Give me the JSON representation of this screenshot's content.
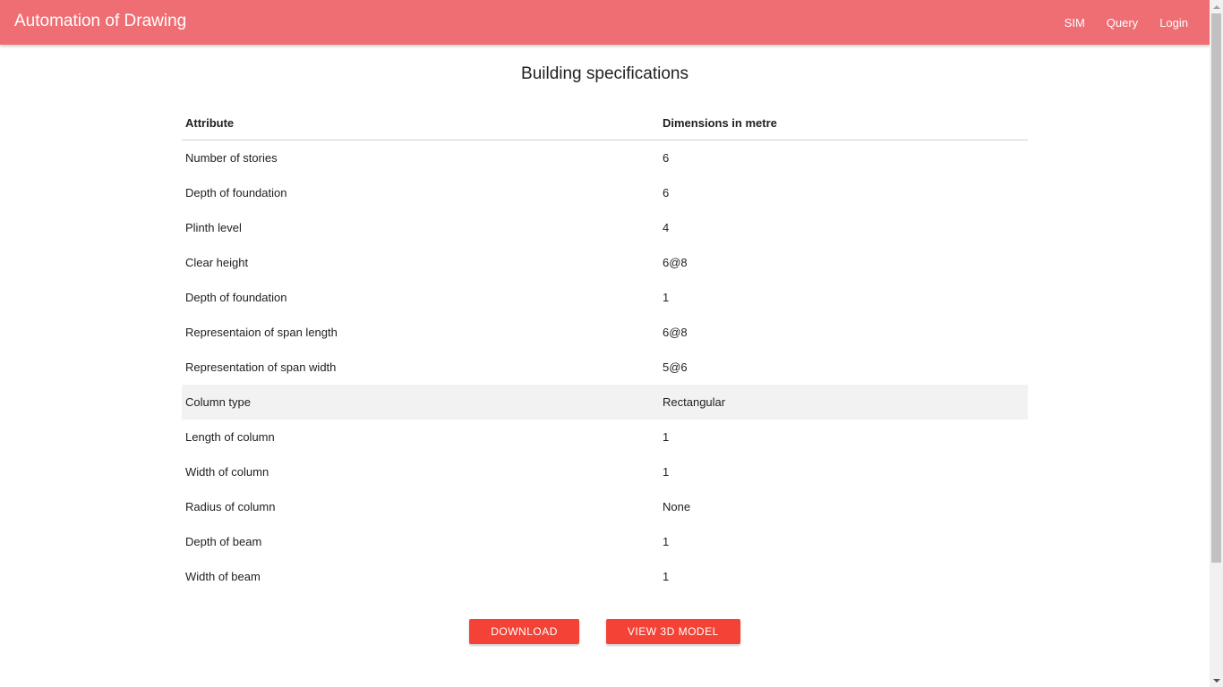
{
  "navbar": {
    "brand": "Automation of Drawing",
    "links": [
      "SIM",
      "Query",
      "Login"
    ]
  },
  "page": {
    "title": "Building specifications"
  },
  "table": {
    "headers": [
      "Attribute",
      "Dimensions in metre"
    ],
    "rows": [
      [
        "Number of stories",
        "6"
      ],
      [
        "Depth of foundation",
        "6"
      ],
      [
        "Plinth level",
        "4"
      ],
      [
        "Clear height",
        "6@8"
      ],
      [
        "Depth of foundation",
        "1"
      ],
      [
        "Representaion of span length",
        "6@8"
      ],
      [
        "Representation of span width",
        "5@6"
      ],
      [
        "Column type",
        "Rectangular"
      ],
      [
        "Length of column",
        "1"
      ],
      [
        "Width of column",
        "1"
      ],
      [
        "Radius of column",
        "None"
      ],
      [
        "Depth of beam",
        "1"
      ],
      [
        "Width of beam",
        "1"
      ]
    ]
  },
  "actions": {
    "download_label": "DOWNLOAD",
    "view_3d_label": "VIEW 3D MODEL"
  },
  "colors": {
    "navbar": "#ef6e73",
    "button": "#f44336",
    "row_hover": "#f2f2f2"
  }
}
